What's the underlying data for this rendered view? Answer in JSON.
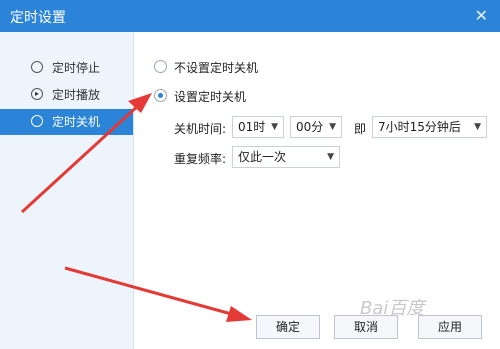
{
  "window": {
    "title": "定时设置",
    "close_label": "✕"
  },
  "sidebar": {
    "items": [
      {
        "label": "定时停止",
        "icon": "stop-clock-icon"
      },
      {
        "label": "定时播放",
        "icon": "play-clock-icon"
      },
      {
        "label": "定时关机",
        "icon": "power-icon",
        "active": true
      }
    ]
  },
  "options": {
    "no_shutdown_label": "不设置定时关机",
    "set_shutdown_label": "设置定时关机",
    "selected": "set_shutdown"
  },
  "shutdown_time": {
    "label": "关机时间:",
    "hour": "01时",
    "minute": "00分",
    "connector": "即",
    "countdown": "7小时15分钟后"
  },
  "repeat": {
    "label": "重复频率:",
    "value": "仅此一次"
  },
  "buttons": {
    "ok": "确定",
    "cancel": "取消",
    "apply": "应用"
  },
  "watermark": "Bai百度"
}
